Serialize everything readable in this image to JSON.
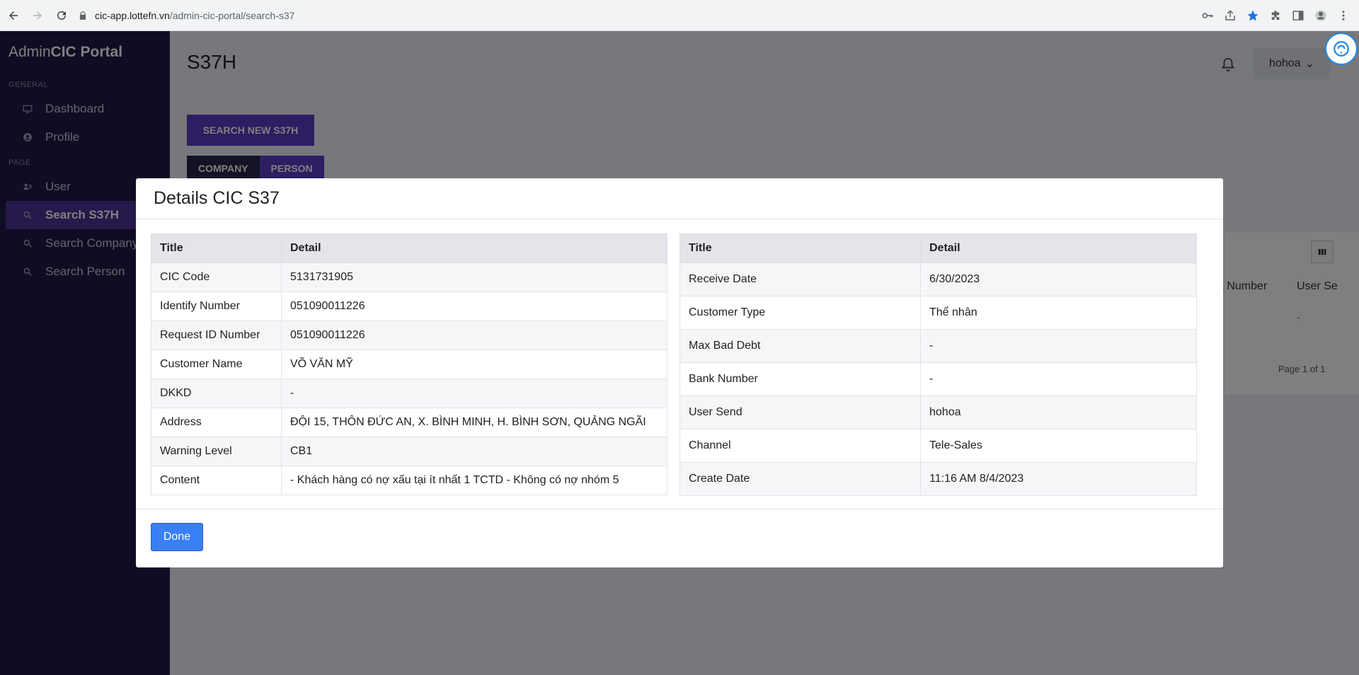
{
  "browser": {
    "url_domain": "cic-app.lottefn.vn",
    "url_path": "/admin-cic-portal/search-s37"
  },
  "sidebar": {
    "brand_light": "Admin",
    "brand_bold": "CIC Portal",
    "general_label": "GENERAL",
    "page_label": "PAGE",
    "items": [
      {
        "label": "Dashboard",
        "icon": "monitor-icon"
      },
      {
        "label": "Profile",
        "icon": "user-circle-icon"
      },
      {
        "label": "User",
        "icon": "users-icon"
      },
      {
        "label": "Search S37H",
        "icon": "search-icon",
        "active": true
      },
      {
        "label": "Search Company",
        "icon": "search-icon"
      },
      {
        "label": "Search Person",
        "icon": "search-icon"
      }
    ]
  },
  "main": {
    "title": "S37H",
    "user": "hohoa",
    "search_new_label": "SEARCH NEW S37H",
    "tab_company": "COMPANY",
    "tab_person": "PERSON",
    "col_bank_number": "nk Number",
    "col_user_send": "User Se",
    "dash": "-",
    "page_info": "Page 1 of 1"
  },
  "modal": {
    "title": "Details CIC S37",
    "left_table": {
      "headers": [
        "Title",
        "Detail"
      ],
      "rows": [
        [
          "CIC Code",
          "5131731905"
        ],
        [
          "Identify Number",
          "051090011226"
        ],
        [
          "Request ID Number",
          "051090011226"
        ],
        [
          "Customer Name",
          "VÕ VĂN MỸ"
        ],
        [
          "DKKD",
          "-"
        ],
        [
          "Address",
          "ĐỘI 15, THÔN ĐỨC AN, X. BÌNH MINH, H. BÌNH SƠN, QUẢNG NGÃI"
        ],
        [
          "Warning Level",
          "CB1"
        ],
        [
          "Content",
          "- Khách hàng có nợ xấu tại ít nhất 1 TCTD - Không có nợ nhóm 5"
        ]
      ]
    },
    "right_table": {
      "headers": [
        "Title",
        "Detail"
      ],
      "rows": [
        [
          "Receive Date",
          "6/30/2023"
        ],
        [
          "Customer Type",
          "Thể nhân"
        ],
        [
          "Max Bad Debt",
          "-"
        ],
        [
          "Bank Number",
          "-"
        ],
        [
          "User Send",
          "hohoa"
        ],
        [
          "Channel",
          "Tele-Sales"
        ],
        [
          "Create Date",
          "11:16 AM 8/4/2023"
        ]
      ]
    },
    "done_label": "Done"
  }
}
